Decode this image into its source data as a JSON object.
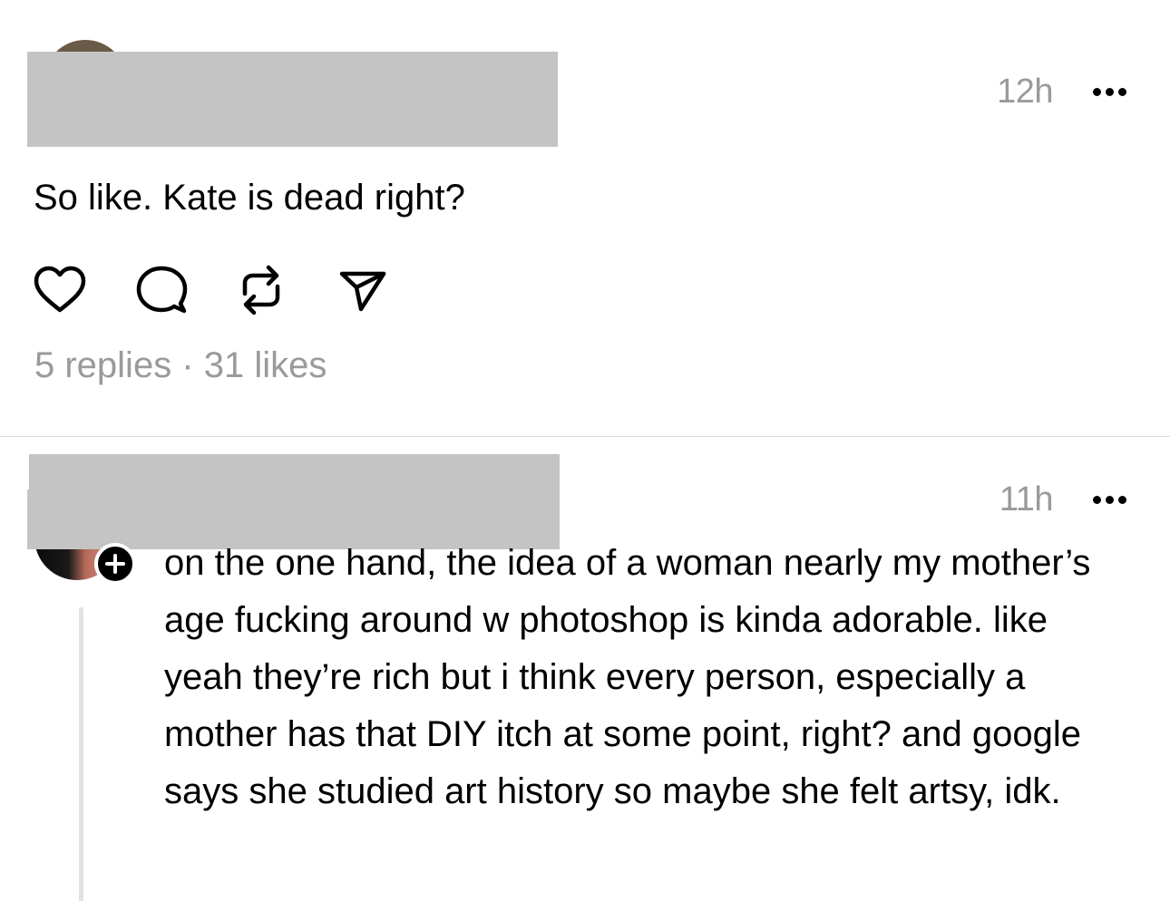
{
  "posts": [
    {
      "timestamp": "12h",
      "text": "So like. Kate is dead right?",
      "stats": "5 replies · 31 likes"
    },
    {
      "timestamp": "11h",
      "text": "on the one hand, the idea of a woman nearly my mother’s age fucking around w photoshop is kinda adorable. like yeah they’re rich but i think every person, especially a mother has that DIY itch at some point, right? and google says she studied art history so maybe she felt artsy, idk."
    }
  ],
  "icons": {
    "like": "heart-icon",
    "reply": "comment-icon",
    "repost": "repost-icon",
    "share": "send-icon",
    "more": "more-icon",
    "follow": "plus-icon"
  },
  "colors": {
    "text": "#000000",
    "muted": "#9a9a9a",
    "redaction": "#c4c4c4",
    "divider": "#dcdcdc"
  }
}
